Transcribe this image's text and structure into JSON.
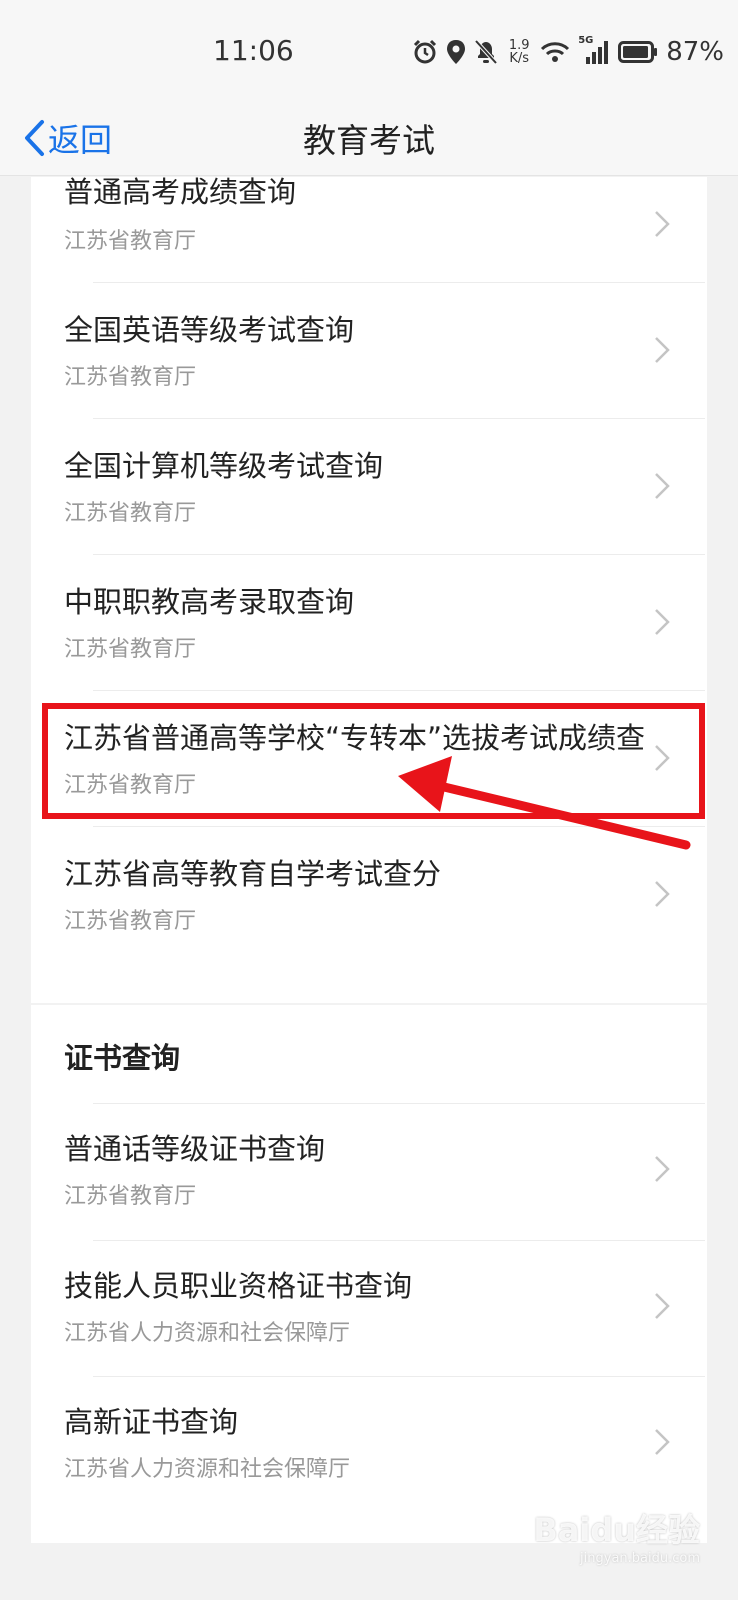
{
  "status_bar": {
    "time": "11:06",
    "net_speed_value": "1.9",
    "net_speed_unit": "K/s",
    "signal_label": "5G",
    "battery": "87%"
  },
  "nav": {
    "back_label": "返回",
    "title": "教育考试"
  },
  "exam_items": [
    {
      "title": "普通高考成绩查询",
      "subtitle": "江苏省教育厅"
    },
    {
      "title": "全国英语等级考试查询",
      "subtitle": "江苏省教育厅"
    },
    {
      "title": "全国计算机等级考试查询",
      "subtitle": "江苏省教育厅"
    },
    {
      "title": "中职职教高考录取查询",
      "subtitle": "江苏省教育厅"
    },
    {
      "title": "江苏省普通高等学校“专转本”选拔考试成绩查",
      "subtitle": "江苏省教育厅"
    },
    {
      "title": "江苏省高等教育自学考试查分",
      "subtitle": "江苏省教育厅"
    }
  ],
  "cert_section": {
    "title": "证书查询",
    "items": [
      {
        "title": "普通话等级证书查询",
        "subtitle": "江苏省教育厅"
      },
      {
        "title": "技能人员职业资格证书查询",
        "subtitle": "江苏省人力资源和社会保障厅"
      },
      {
        "title": "高新证书查询",
        "subtitle": "江苏省人力资源和社会保障厅"
      }
    ]
  },
  "watermark": {
    "brand": "Baidu经验",
    "url": "jingyan.baidu.com"
  },
  "colors": {
    "accent": "#1a73e8",
    "highlight": "#e8141a"
  }
}
